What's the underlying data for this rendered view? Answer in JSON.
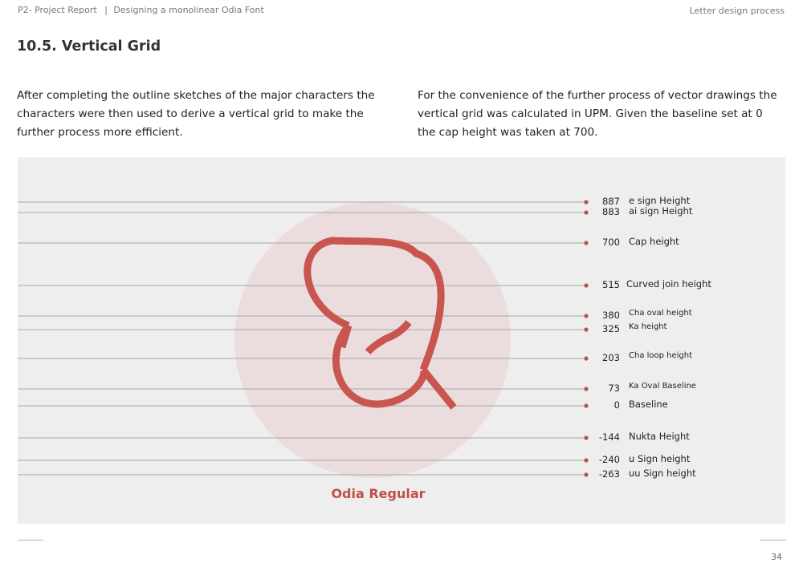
{
  "header": {
    "report_label": "P2- Project Report",
    "separator": "|",
    "report_topic": "Designing a monolinear Odia Font",
    "section_label": "Letter design process"
  },
  "section_title": "10.5. Vertical Grid",
  "paragraphs": {
    "left": "After completing the outline sketches of the major characters the characters were then used to derive a vertical grid to make the further process more efficient.",
    "right": "For the convenience of the further process of vector drawings the vertical grid was calculated in UPM. Given the baseline set at 0 the cap height was taken at 700."
  },
  "grid_lines": [
    {
      "value": "887",
      "label": "e sign Height"
    },
    {
      "value": "883",
      "label": "ai sign Height"
    },
    {
      "value": "700",
      "label": "Cap height"
    },
    {
      "value": "515",
      "label": "Curved join height"
    },
    {
      "value": "380",
      "label": "Cha oval height"
    },
    {
      "value": "325",
      "label": "Ka height"
    },
    {
      "value": "203",
      "label": "Cha loop height"
    },
    {
      "value": "73",
      "label": "Ka Oval Baseline"
    },
    {
      "value": "0",
      "label": "Baseline"
    },
    {
      "value": "-144",
      "label": "Nukta Height"
    },
    {
      "value": "-240",
      "label": "u Sign height"
    },
    {
      "value": "-263",
      "label": "uu Sign height"
    }
  ],
  "caption": "Odia Regular",
  "colors": {
    "accent": "#bd5049",
    "glyph": "#c9554f",
    "circle": "#ebdddd",
    "panel": "#efeeee",
    "grid_line": "#a8a8a8"
  },
  "page_number": "34"
}
